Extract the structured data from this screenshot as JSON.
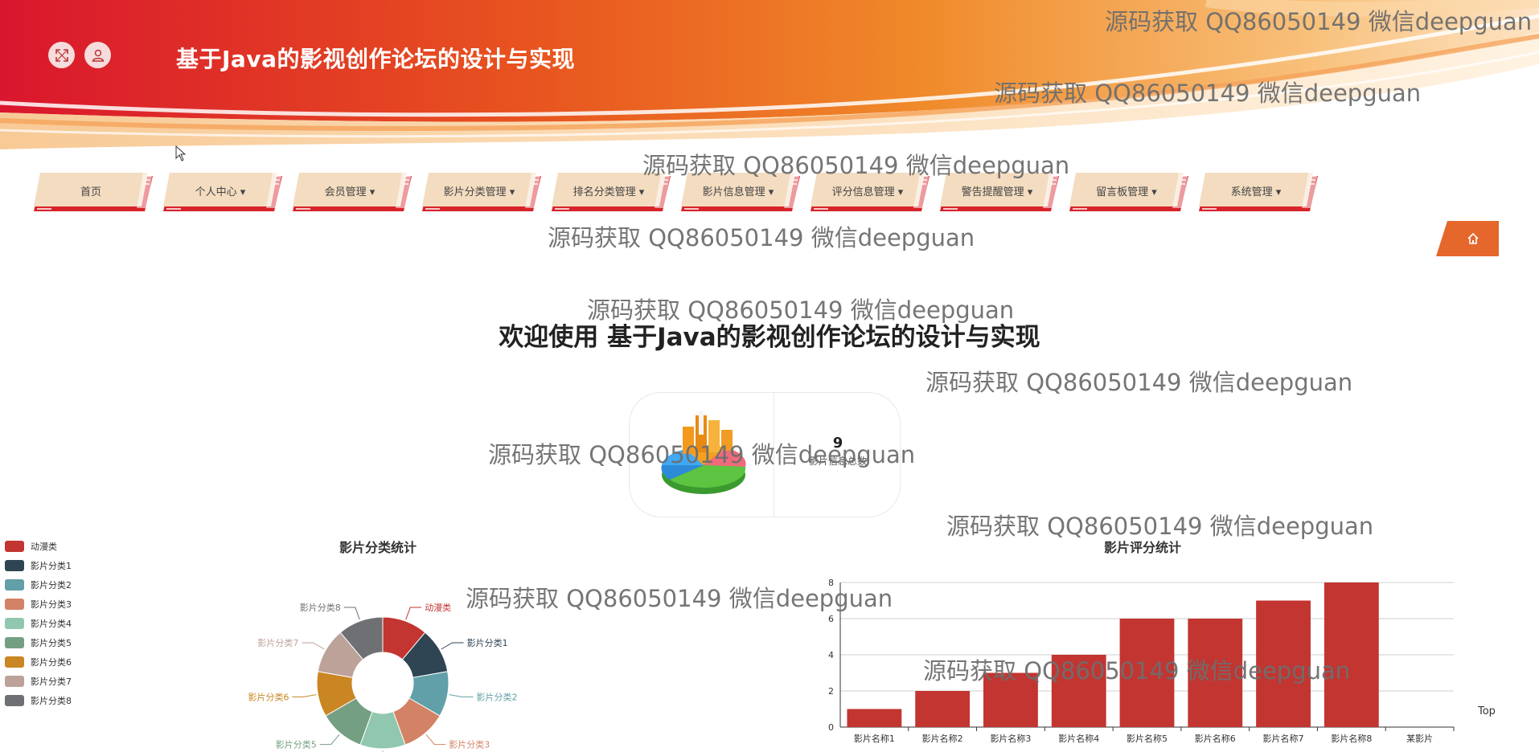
{
  "header": {
    "title": "基于Java的影视创作论坛的设计与实现",
    "fullscreen_icon": "expand-icon",
    "user_icon": "user-icon"
  },
  "nav": {
    "items": [
      {
        "label": "首页"
      },
      {
        "label": "个人中心 ▾"
      },
      {
        "label": "会员管理 ▾"
      },
      {
        "label": "影片分类管理 ▾"
      },
      {
        "label": "排名分类管理 ▾"
      },
      {
        "label": "影片信息管理 ▾"
      },
      {
        "label": "评分信息管理 ▾"
      },
      {
        "label": "警告提醒管理 ▾"
      },
      {
        "label": "留言板管理 ▾"
      },
      {
        "label": "系统管理 ▾"
      }
    ],
    "home_icon": "home-icon"
  },
  "welcome": {
    "text": "欢迎使用 基于Java的影视创作论坛的设计与实现"
  },
  "stat": {
    "value": "9",
    "label": "影片信息总数",
    "icon": "pie-chart-3d-icon"
  },
  "watermark": {
    "text": "源码获取 QQ86050149 微信deepguan"
  },
  "top_link": "Top",
  "colors": {
    "accent": "#c23531",
    "nav_bg": "#f3dcc0",
    "nav_shadow": "#d8232a"
  },
  "chart_data": [
    {
      "type": "pie",
      "title": "影片分类统计",
      "donut": true,
      "legend_position": "left",
      "categories": [
        "动漫类",
        "影片分类1",
        "影片分类2",
        "影片分类3",
        "影片分类4",
        "影片分类5",
        "影片分类6",
        "影片分类7",
        "影片分类8"
      ],
      "values": [
        1,
        1,
        1,
        1,
        1,
        1,
        1,
        1,
        1
      ],
      "colors": [
        "#c23531",
        "#2f4554",
        "#61a0a8",
        "#d48265",
        "#91c7ae",
        "#749f83",
        "#ca8622",
        "#bda29a",
        "#6e7074"
      ]
    },
    {
      "type": "bar",
      "title": "影片评分统计",
      "categories": [
        "影片名称1",
        "影片名称2",
        "影片名称3",
        "影片名称4",
        "影片名称5",
        "影片名称6",
        "影片名称7",
        "影片名称8",
        "某影片"
      ],
      "values": [
        1,
        2,
        3,
        4,
        6,
        6,
        7,
        8,
        0
      ],
      "ylim": [
        0,
        8
      ],
      "yticks": [
        0,
        2,
        4,
        6,
        8
      ],
      "grid": true,
      "color": "#c23531"
    }
  ]
}
